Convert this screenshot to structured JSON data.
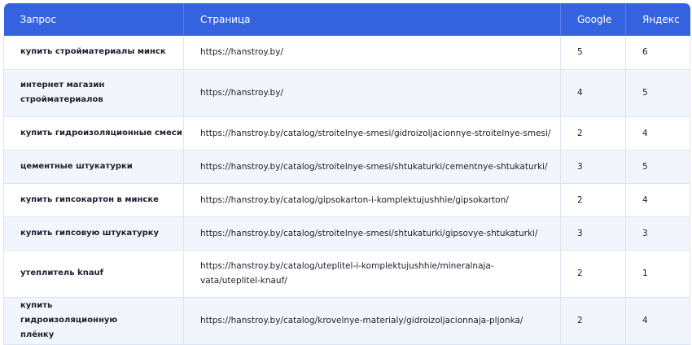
{
  "table": {
    "headers": [
      "Запрос",
      "Страница",
      "Google",
      "Яндекс"
    ],
    "rows": [
      {
        "query": "купить стройматериалы минск",
        "page": "https://hanstroy.by/",
        "google": "5",
        "yandex": "6"
      },
      {
        "query": "интернет магазин стройматериалов",
        "page": "https://hanstroy.by/",
        "google": "4",
        "yandex": "5"
      },
      {
        "query": "купить гидроизоляционные смеси",
        "page": "https://hanstroy.by/catalog/stroitelnye-smesi/gidroizoljacionnye-stroitelnye-smesi/",
        "google": "2",
        "yandex": "4"
      },
      {
        "query": "цементные штукатурки",
        "page": "https://hanstroy.by/catalog/stroitelnye-smesi/shtukaturki/cementnye-shtukaturki/",
        "google": "3",
        "yandex": "5"
      },
      {
        "query": "купить гипсокартон в минске",
        "page": "https://hanstroy.by/catalog/gipsokarton-i-komplektujushhie/gipsokarton/",
        "google": "2",
        "yandex": "4"
      },
      {
        "query": "купить гипсовую штукатурку",
        "page": "https://hanstroy.by/catalog/stroitelnye-smesi/shtukaturki/gipsovye-shtukaturki/",
        "google": "3",
        "yandex": "3"
      },
      {
        "query": "утеплитель knauf",
        "page": "https://hanstroy.by/catalog/uteplitel-i-komplektujushhie/mineralnaja-vata/uteplitel-knauf/",
        "google": "2",
        "yandex": "1"
      },
      {
        "query": "купить гидроизоляционную плёнку",
        "page": "https://hanstroy.by/catalog/krovelnye-materialy/gidroizoljacionnaja-pljonka/",
        "google": "2",
        "yandex": "4"
      }
    ]
  }
}
